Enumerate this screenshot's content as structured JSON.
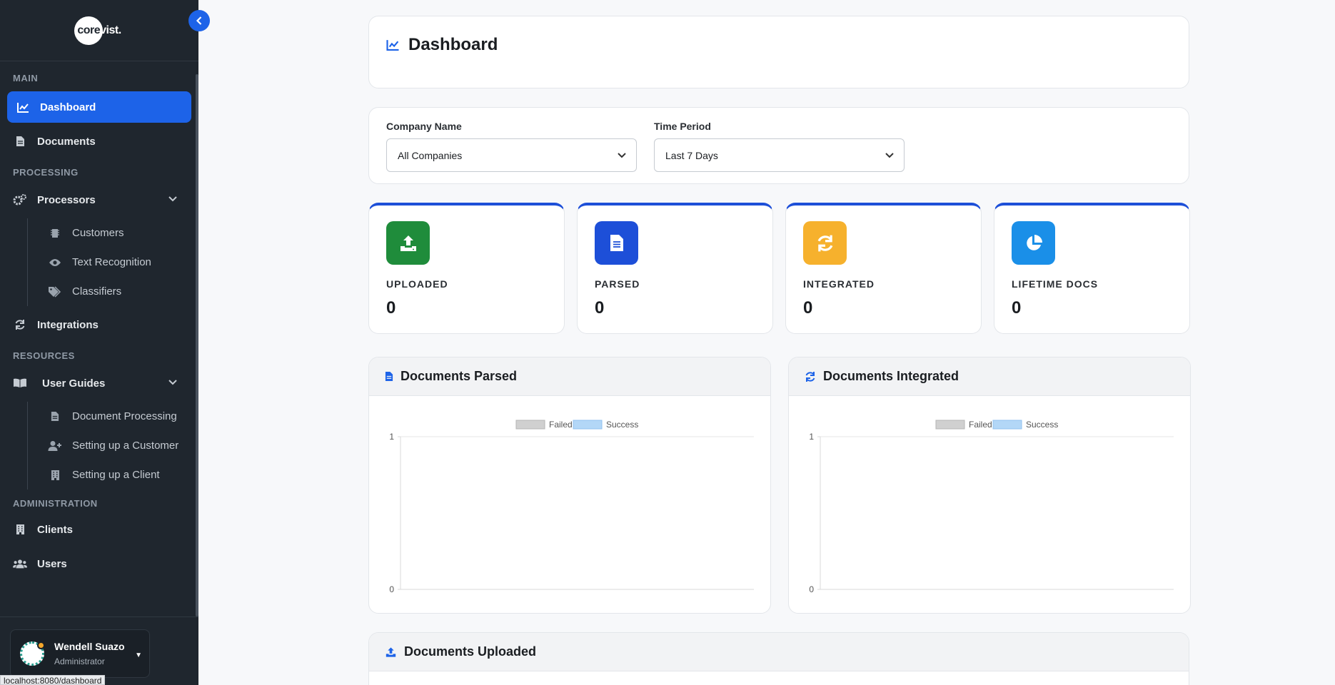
{
  "sidebar": {
    "logo_prefix": "core",
    "logo_rest": "vist.",
    "sections": {
      "main": "MAIN",
      "processing": "PROCESSING",
      "resources": "RESOURCES",
      "administration": "ADMINISTRATION"
    },
    "items": {
      "dashboard": "Dashboard",
      "documents": "Documents",
      "processors": "Processors",
      "customers": "Customers",
      "text_recognition": "Text Recognition",
      "classifiers": "Classifiers",
      "integrations": "Integrations",
      "user_guides": "User Guides",
      "document_processing": "Document Processing",
      "setting_up_customer": "Setting up a Customer",
      "setting_up_client": "Setting up a Client",
      "clients": "Clients",
      "users": "Users"
    },
    "user": {
      "name": "Wendell Suazo",
      "role": "Administrator"
    }
  },
  "status_url": "localhost:8080/dashboard",
  "header": {
    "title": "Dashboard"
  },
  "filters": {
    "company": {
      "label": "Company Name",
      "value": "All Companies"
    },
    "period": {
      "label": "Time Period",
      "value": "Last 7 Days"
    }
  },
  "stats": [
    {
      "label": "UPLOADED",
      "value": "0",
      "color": "#1f8c3b",
      "icon": "upload-icon"
    },
    {
      "label": "PARSED",
      "value": "0",
      "color": "#1d4fd8",
      "icon": "file-icon"
    },
    {
      "label": "INTEGRATED",
      "value": "0",
      "color": "#f6b12d",
      "icon": "sync-icon"
    },
    {
      "label": "LIFETIME DOCS",
      "value": "0",
      "color": "#1a8fe8",
      "icon": "pie-chart-icon"
    }
  ],
  "charts": {
    "parsed_title": "Documents Parsed",
    "integrated_title": "Documents Integrated",
    "uploaded_title": "Documents Uploaded"
  },
  "chart_data": [
    {
      "type": "bar",
      "title": "Documents Parsed",
      "series": [
        {
          "name": "Failed",
          "values": [],
          "color": "#d0d0d0"
        },
        {
          "name": "Success",
          "values": [],
          "color": "#b3d7f7"
        }
      ],
      "categories": [],
      "ylim": [
        0,
        1
      ],
      "yticks": [
        "1",
        "0"
      ],
      "legend": "top-center"
    },
    {
      "type": "bar",
      "title": "Documents Integrated",
      "series": [
        {
          "name": "Failed",
          "values": [],
          "color": "#d0d0d0"
        },
        {
          "name": "Success",
          "values": [],
          "color": "#b3d7f7"
        }
      ],
      "categories": [],
      "ylim": [
        0,
        1
      ],
      "yticks": [
        "1",
        "0"
      ],
      "legend": "top-center"
    }
  ]
}
